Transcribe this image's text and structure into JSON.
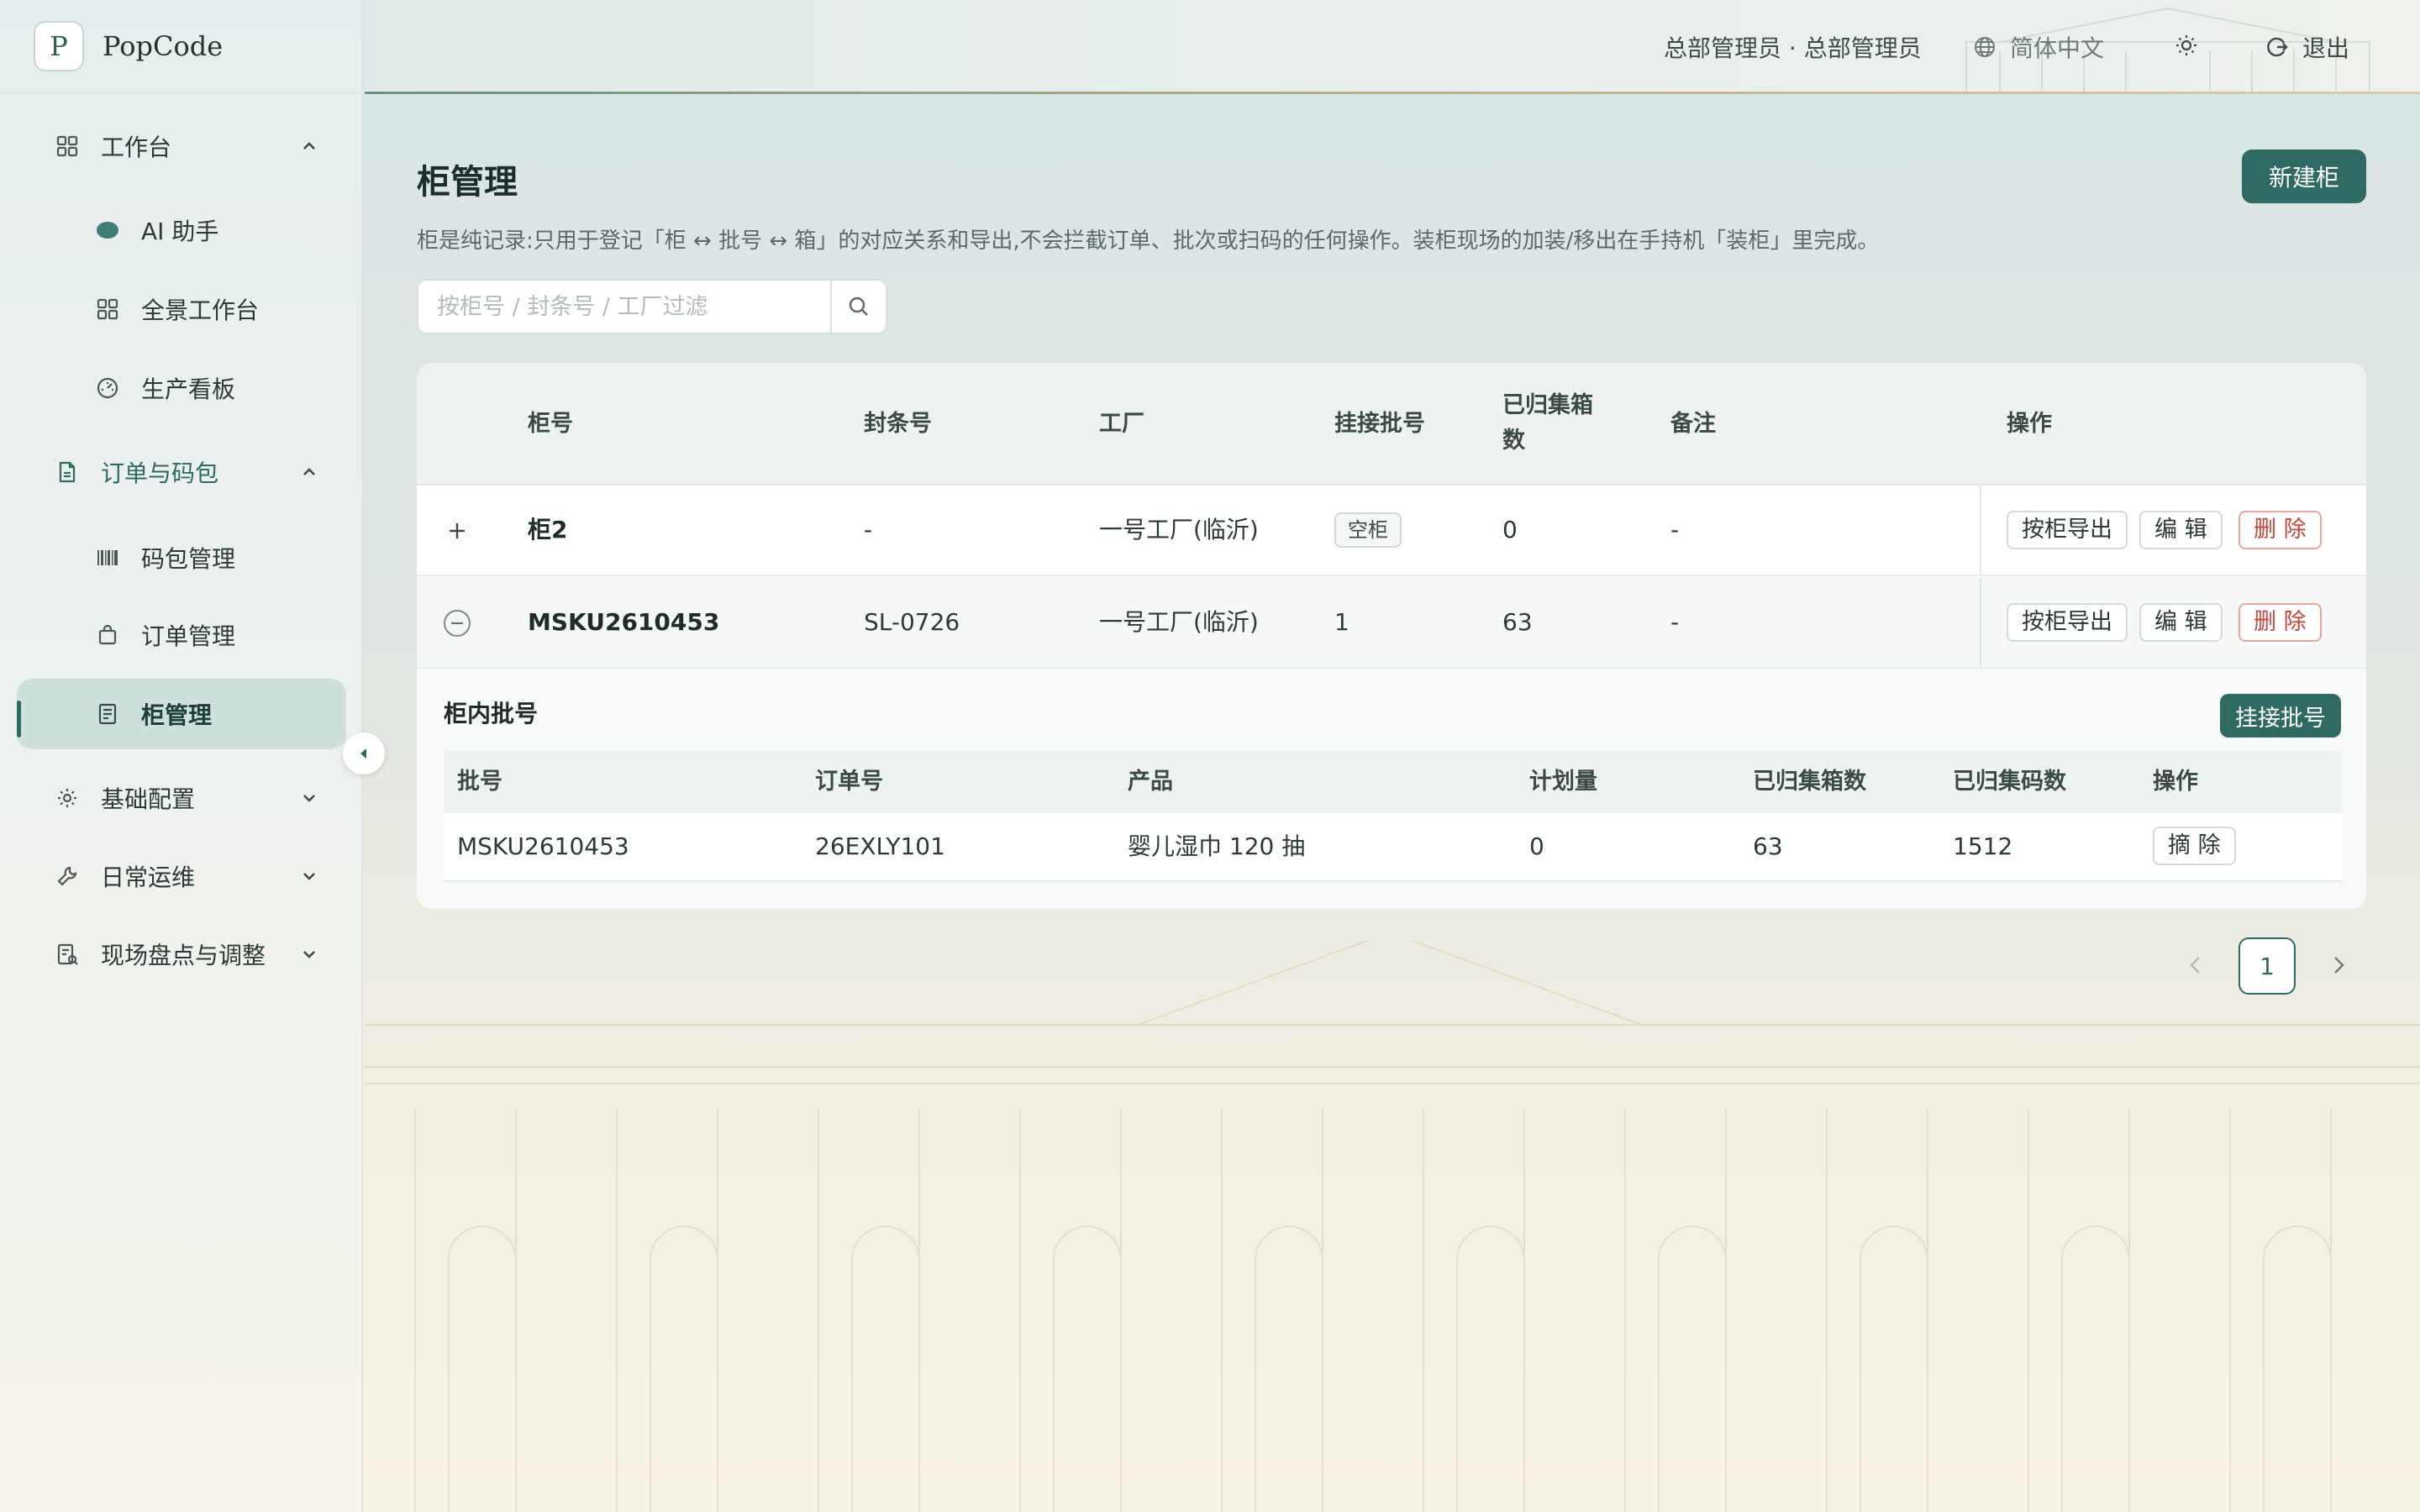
{
  "brand": {
    "logo_letter": "P",
    "name": "PopCode"
  },
  "sidebar": {
    "groups": [
      {
        "label": "工作台",
        "icon": "grid-icon",
        "expanded": true,
        "items": [
          {
            "label": "AI 助手",
            "icon": "ai-dot-icon"
          },
          {
            "label": "全景工作台",
            "icon": "grid-icon"
          },
          {
            "label": "生产看板",
            "icon": "gauge-icon"
          }
        ]
      },
      {
        "label": "订单与码包",
        "icon": "document-icon",
        "expanded": true,
        "items": [
          {
            "label": "码包管理",
            "icon": "barcode-icon"
          },
          {
            "label": "订单管理",
            "icon": "bag-icon"
          },
          {
            "label": "柜管理",
            "icon": "list-doc-icon",
            "selected": true
          }
        ]
      },
      {
        "label": "基础配置",
        "icon": "gear-icon",
        "expanded": false
      },
      {
        "label": "日常运维",
        "icon": "wrench-icon",
        "expanded": false
      },
      {
        "label": "现场盘点与调整",
        "icon": "checklist-icon",
        "expanded": false
      }
    ]
  },
  "header": {
    "user": "总部管理员 · 总部管理员",
    "language": "简体中文",
    "logout": "退出"
  },
  "page": {
    "title": "柜管理",
    "description": "柜是纯记录:只用于登记「柜 ↔ 批号 ↔ 箱」的对应关系和导出,不会拦截订单、批次或扫码的任何操作。装柜现场的加装/移出在手持机「装柜」里完成。",
    "new_button": "新建柜",
    "search_placeholder": "按柜号 / 封条号 / 工厂过滤"
  },
  "table": {
    "columns": [
      "柜号",
      "封条号",
      "工厂",
      "挂接批号",
      "已归集箱数",
      "备注",
      "操作"
    ],
    "rows": [
      {
        "container": "柜2",
        "seal": "-",
        "factory": "一号工厂(临沂)",
        "batch": "空柜",
        "boxes": "0",
        "remark": "-",
        "expanded": false
      },
      {
        "container": "MSKU2610453",
        "seal": "SL-0726",
        "factory": "一号工厂(临沂)",
        "batch": "1",
        "boxes": "63",
        "remark": "-",
        "expanded": true
      }
    ],
    "actions": {
      "export": "按柜导出",
      "edit": "编 辑",
      "delete": "删 除"
    }
  },
  "subtable": {
    "title": "柜内批号",
    "attach_button": "挂接批号",
    "columns": [
      "批号",
      "订单号",
      "产品",
      "计划量",
      "已归集箱数",
      "已归集码数",
      "操作"
    ],
    "rows": [
      {
        "batch": "MSKU2610453",
        "order": "26EXLY101",
        "product": "婴儿湿巾 120 抽",
        "plan": "0",
        "boxes": "63",
        "codes": "1512",
        "action": "摘 除"
      }
    ]
  },
  "pagination": {
    "current": "1"
  },
  "colors": {
    "accent": "#2f6a62",
    "danger": "#c9463d",
    "sidebar_selected": "#cfe0dc"
  }
}
